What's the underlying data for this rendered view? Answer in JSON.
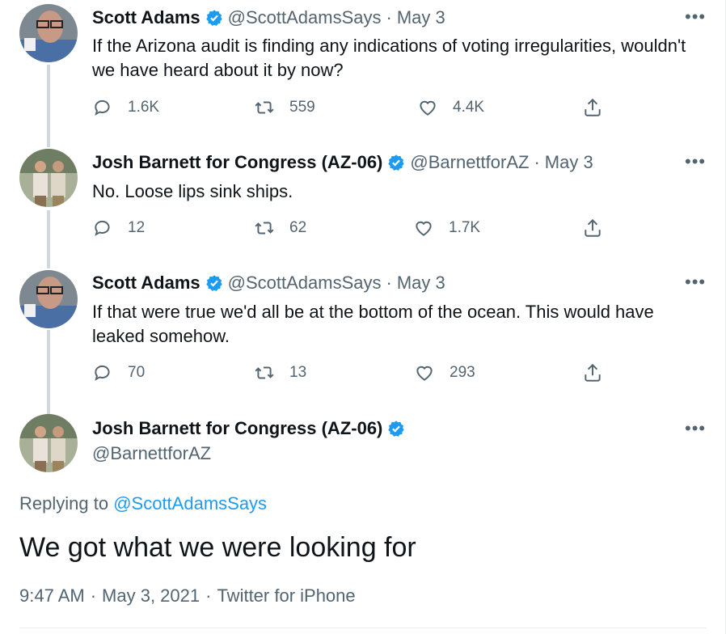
{
  "tweets": [
    {
      "name": "Scott Adams",
      "handle": "@ScottAdamsSays",
      "date": "May 3",
      "text": "If the Arizona audit is finding any indications of voting irregularities, wouldn't we have heard about it by now?",
      "replies": "1.6K",
      "retweets": "559",
      "likes": "4.4K"
    },
    {
      "name": "Josh Barnett for Congress (AZ-06)",
      "handle": "@BarnettforAZ",
      "date": "May 3",
      "text": "No. Loose lips sink ships.",
      "replies": "12",
      "retweets": "62",
      "likes": "1.7K"
    },
    {
      "name": "Scott Adams",
      "handle": "@ScottAdamsSays",
      "date": "May 3",
      "text": "If that were true we'd all be at the bottom of the ocean. This would have leaked somehow.",
      "replies": "70",
      "retweets": "13",
      "likes": "293"
    }
  ],
  "main_tweet": {
    "name": "Josh Barnett for Congress (AZ-06)",
    "handle": "@BarnettforAZ",
    "replying_prefix": "Replying to",
    "replying_to": "@ScottAdamsSays",
    "text": "We got what we were looking for",
    "time": "9:47 AM",
    "date": "May 3, 2021",
    "source": "Twitter for iPhone"
  },
  "ui": {
    "separator": "·",
    "more": "•••"
  },
  "colors": {
    "accent": "#1d9bf0",
    "secondary_text": "#536471",
    "thread_line": "#cfd9de"
  }
}
